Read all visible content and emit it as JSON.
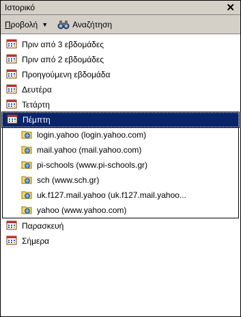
{
  "window": {
    "title": "Ιστορικό",
    "close_glyph": "✕"
  },
  "toolbar": {
    "view_label": "Προβολή",
    "view_caret": "▼",
    "search_label": "Αναζήτηση"
  },
  "history": {
    "before_days": [
      {
        "label": "Πριν από 3 εβδομάδες",
        "icon": "calendar-icon"
      },
      {
        "label": "Πριν από 2 εβδομάδες",
        "icon": "calendar-icon"
      },
      {
        "label": "Προηγούμενη εβδομάδα",
        "icon": "calendar-icon"
      },
      {
        "label": "Δευτέρα",
        "icon": "calendar-icon"
      },
      {
        "label": "Τετάρτη",
        "icon": "calendar-icon"
      }
    ],
    "selected_day": {
      "label": "Πέμπτη",
      "icon": "calendar-icon"
    },
    "sites": [
      {
        "label": "login.yahoo (login.yahoo.com)",
        "icon": "web-folder-icon"
      },
      {
        "label": "mail.yahoo (mail.yahoo.com)",
        "icon": "web-folder-icon"
      },
      {
        "label": "pi-schools (www.pi-schools.gr)",
        "icon": "web-folder-icon"
      },
      {
        "label": "sch (www.sch.gr)",
        "icon": "web-folder-icon"
      },
      {
        "label": "uk.f127.mail.yahoo (uk.f127.mail.yahoo...",
        "icon": "web-folder-icon"
      },
      {
        "label": "yahoo (www.yahoo.com)",
        "icon": "web-folder-icon"
      }
    ],
    "after_days": [
      {
        "label": "Παρασκευή",
        "icon": "calendar-icon"
      },
      {
        "label": "Σήμερα",
        "icon": "calendar-icon"
      }
    ]
  },
  "colors": {
    "selection_bg": "#0a246a",
    "chrome_bg": "#d4d0c8"
  }
}
